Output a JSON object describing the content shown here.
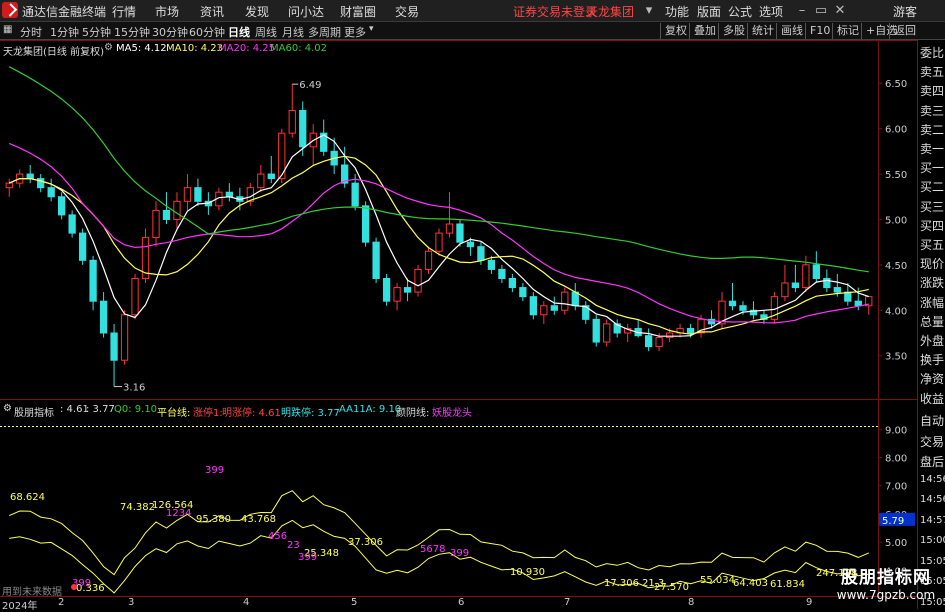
{
  "app": {
    "title": "通达信金融终端",
    "menu": [
      "行情",
      "市场",
      "资讯",
      "发现",
      "问小达",
      "财富圈",
      "交易"
    ],
    "notice": "证券交易未登录",
    "stock_name": "天龙集团",
    "right_menu": [
      "功能",
      "版面",
      "公式",
      "选项"
    ],
    "guest": "游客",
    "win_icons": [
      "window-toggle-icon",
      "minimize-icon",
      "restore-icon",
      "close-icon"
    ]
  },
  "periods": [
    "分时",
    "1分钟",
    "5分钟",
    "15分钟",
    "30分钟",
    "60分钟",
    "日线",
    "周线",
    "月线",
    "多周期",
    "更多"
  ],
  "active_period": "日线",
  "right_tools": [
    "复权",
    "叠加",
    "多股",
    "统计",
    "画线",
    "F10",
    "标记",
    "+自选",
    "返回"
  ],
  "main_legend": {
    "title": "天龙集团(日线 前复权)",
    "ma5": "MA5: 4.12",
    "ma10": "MA10: 4.23",
    "ma20": "MA20: 4.25",
    "ma60": "MA60: 4.02"
  },
  "price_axis": [
    "6.50",
    "6.00",
    "5.50",
    "5.00",
    "4.50",
    "4.00",
    "3.50"
  ],
  "annotations": {
    "high": "6.49",
    "low": "3.16"
  },
  "sub_legend": {
    "name": "股朋指标",
    "v1": ": 4.61",
    "v2": ": 3.77",
    "q0": "Q0: 9.10",
    "p1": "平台线:",
    "p2": "涨停1:",
    "p3": "明涨停: 4.61",
    "p4": "明跌停: 3.77",
    "p5": "AA11A: 9.10",
    "p6": "颜阴线:",
    "p7": "妖股龙头"
  },
  "sub_axis": [
    "9.00",
    "8.00",
    "7.00",
    "6.00",
    "5.00",
    "4.00"
  ],
  "sub_marker": "5.79",
  "sub_labels": [
    "68.624",
    "74.382",
    "126.564",
    "95.380",
    "43.768",
    "37.306",
    "25.348",
    "10.930",
    "17.306",
    "21.3",
    "27.570",
    "55.034",
    "64.403",
    "61.834",
    "247.128",
    "399",
    "399",
    "399",
    "0.336",
    "1234",
    "5678",
    "456",
    "23",
    "399"
  ],
  "bottom_note": "用到未来数据",
  "x_axis": [
    "2024年",
    "2",
    "3",
    "4",
    "5",
    "6",
    "7",
    "8",
    "9"
  ],
  "right_panel": [
    "委比",
    "卖五",
    "卖四",
    "卖三",
    "卖二",
    "卖一",
    "买一",
    "买二",
    "买三",
    "买四",
    "买五",
    "现价",
    "涨跌",
    "涨幅",
    "总量",
    "外盘",
    "换手",
    "净资",
    "收益",
    "自动",
    "交易",
    "盘后",
    "14:56",
    "14:56",
    "14:57",
    "15:00",
    "15:05",
    "15:05",
    "15:05"
  ],
  "watermark": {
    "line1": "股朋指标网",
    "line2": "www.7gpzb.com"
  },
  "colors": {
    "up": "#ff3333",
    "down": "#33e0e0",
    "ma5": "#ffffff",
    "ma10": "#ffff55",
    "ma20": "#ff33ff",
    "ma60": "#33cc33",
    "axis": "#7a1010",
    "accent": "#d21b1b"
  },
  "chart_data": {
    "type": "candlestick",
    "title": "天龙集团(日线 前复权)",
    "ylim": [
      3.1,
      6.8
    ],
    "candles": [
      [
        5.35,
        5.45,
        5.25,
        5.4
      ],
      [
        5.4,
        5.55,
        5.35,
        5.5
      ],
      [
        5.5,
        5.6,
        5.4,
        5.45
      ],
      [
        5.45,
        5.5,
        5.3,
        5.35
      ],
      [
        5.35,
        5.45,
        5.2,
        5.25
      ],
      [
        5.25,
        5.3,
        5.0,
        5.05
      ],
      [
        5.05,
        5.1,
        4.8,
        4.85
      ],
      [
        4.85,
        4.9,
        4.5,
        4.55
      ],
      [
        4.55,
        4.6,
        4.0,
        4.1
      ],
      [
        4.1,
        4.2,
        3.7,
        3.75
      ],
      [
        3.75,
        3.85,
        3.16,
        3.45
      ],
      [
        3.45,
        4.0,
        3.4,
        3.95
      ],
      [
        3.95,
        4.4,
        3.9,
        4.35
      ],
      [
        4.35,
        4.9,
        4.3,
        4.8
      ],
      [
        4.8,
        5.2,
        4.7,
        5.1
      ],
      [
        5.1,
        5.3,
        4.95,
        5.0
      ],
      [
        5.0,
        5.3,
        4.9,
        5.2
      ],
      [
        5.2,
        5.5,
        5.1,
        5.35
      ],
      [
        5.35,
        5.45,
        5.15,
        5.2
      ],
      [
        5.2,
        5.3,
        5.05,
        5.15
      ],
      [
        5.15,
        5.35,
        5.1,
        5.3
      ],
      [
        5.3,
        5.4,
        5.2,
        5.25
      ],
      [
        5.25,
        5.35,
        5.1,
        5.2
      ],
      [
        5.2,
        5.4,
        5.15,
        5.35
      ],
      [
        5.35,
        5.6,
        5.3,
        5.5
      ],
      [
        5.5,
        5.7,
        5.4,
        5.45
      ],
      [
        5.45,
        6.0,
        5.4,
        5.95
      ],
      [
        5.95,
        6.49,
        5.9,
        6.2
      ],
      [
        6.2,
        6.3,
        5.7,
        5.8
      ],
      [
        5.8,
        6.05,
        5.6,
        5.95
      ],
      [
        5.95,
        6.1,
        5.7,
        5.75
      ],
      [
        5.75,
        5.9,
        5.5,
        5.6
      ],
      [
        5.6,
        5.8,
        5.35,
        5.4
      ],
      [
        5.4,
        5.5,
        5.1,
        5.15
      ],
      [
        5.15,
        5.2,
        4.7,
        4.75
      ],
      [
        4.75,
        4.8,
        4.3,
        4.35
      ],
      [
        4.35,
        4.4,
        4.05,
        4.1
      ],
      [
        4.1,
        4.3,
        4.0,
        4.25
      ],
      [
        4.25,
        4.35,
        4.1,
        4.2
      ],
      [
        4.2,
        4.5,
        4.15,
        4.45
      ],
      [
        4.45,
        4.7,
        4.4,
        4.65
      ],
      [
        4.65,
        4.9,
        4.6,
        4.85
      ],
      [
        4.85,
        5.3,
        4.8,
        4.95
      ],
      [
        4.95,
        5.0,
        4.7,
        4.75
      ],
      [
        4.75,
        4.8,
        4.6,
        4.7
      ],
      [
        4.7,
        4.75,
        4.5,
        4.55
      ],
      [
        4.55,
        4.6,
        4.4,
        4.45
      ],
      [
        4.45,
        4.5,
        4.3,
        4.35
      ],
      [
        4.35,
        4.4,
        4.2,
        4.25
      ],
      [
        4.25,
        4.3,
        4.1,
        4.15
      ],
      [
        4.15,
        4.2,
        3.9,
        3.95
      ],
      [
        3.95,
        4.1,
        3.85,
        4.05
      ],
      [
        4.05,
        4.15,
        3.95,
        4.0
      ],
      [
        4.0,
        4.25,
        3.95,
        4.2
      ],
      [
        4.2,
        4.3,
        4.0,
        4.05
      ],
      [
        4.05,
        4.1,
        3.85,
        3.9
      ],
      [
        3.9,
        3.95,
        3.6,
        3.65
      ],
      [
        3.65,
        3.9,
        3.6,
        3.85
      ],
      [
        3.85,
        3.9,
        3.7,
        3.75
      ],
      [
        3.75,
        3.85,
        3.65,
        3.8
      ],
      [
        3.8,
        3.9,
        3.7,
        3.72
      ],
      [
        3.72,
        3.8,
        3.55,
        3.6
      ],
      [
        3.6,
        3.75,
        3.55,
        3.7
      ],
      [
        3.7,
        3.8,
        3.65,
        3.75
      ],
      [
        3.75,
        3.85,
        3.7,
        3.8
      ],
      [
        3.8,
        3.85,
        3.7,
        3.75
      ],
      [
        3.75,
        3.95,
        3.7,
        3.9
      ],
      [
        3.9,
        4.0,
        3.8,
        3.85
      ],
      [
        3.85,
        4.2,
        3.8,
        4.1
      ],
      [
        4.1,
        4.3,
        4.0,
        4.05
      ],
      [
        4.05,
        4.1,
        3.95,
        4.0
      ],
      [
        4.0,
        4.1,
        3.9,
        3.95
      ],
      [
        3.95,
        4.0,
        3.85,
        3.9
      ],
      [
        3.9,
        4.2,
        3.85,
        4.15
      ],
      [
        4.15,
        4.5,
        4.1,
        4.3
      ],
      [
        4.3,
        4.5,
        4.2,
        4.25
      ],
      [
        4.25,
        4.6,
        4.2,
        4.5
      ],
      [
        4.5,
        4.65,
        4.3,
        4.35
      ],
      [
        4.35,
        4.45,
        4.2,
        4.25
      ],
      [
        4.25,
        4.4,
        4.15,
        4.2
      ],
      [
        4.2,
        4.3,
        4.05,
        4.1
      ],
      [
        4.1,
        4.25,
        4.0,
        4.05
      ],
      [
        4.05,
        4.15,
        3.95,
        4.15
      ]
    ],
    "series": [
      {
        "name": "MA5",
        "current": 4.12
      },
      {
        "name": "MA10",
        "current": 4.23
      },
      {
        "name": "MA20",
        "current": 4.25
      },
      {
        "name": "MA60",
        "current": 4.02
      }
    ],
    "sub_ylim": [
      3.3,
      9.4
    ],
    "sub_series": [
      {
        "name": "明涨停",
        "current": 4.61
      },
      {
        "name": "明跌停",
        "current": 3.77
      }
    ]
  }
}
